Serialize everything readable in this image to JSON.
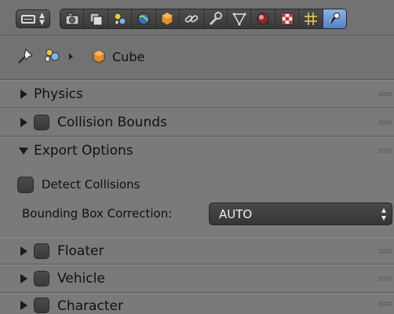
{
  "properties_tabs": [
    {
      "name": "render-icon"
    },
    {
      "name": "render-layers-icon"
    },
    {
      "name": "scene-icon"
    },
    {
      "name": "world-icon"
    },
    {
      "name": "object-icon"
    },
    {
      "name": "constraints-icon"
    },
    {
      "name": "modifiers-icon"
    },
    {
      "name": "data-icon"
    },
    {
      "name": "material-icon"
    },
    {
      "name": "texture-icon"
    },
    {
      "name": "particles-icon"
    },
    {
      "name": "physics-icon",
      "active": true
    }
  ],
  "breadcrumb": {
    "object_name": "Cube"
  },
  "panels": {
    "physics": "Physics",
    "collision_bounds": "Collision Bounds",
    "export_options": "Export Options",
    "floater": "Floater",
    "vehicle": "Vehicle",
    "character": "Character"
  },
  "export_options": {
    "detect_collisions_label": "Detect Collisions",
    "detect_collisions_checked": false,
    "bounding_box_label": "Bounding Box Correction:",
    "bounding_box_value": "AUTO"
  },
  "colors": {
    "background": "#727272",
    "panel": "#7a7a7a",
    "active_tab": "#6f96d6",
    "dark_widget": "#3f3f3f"
  }
}
